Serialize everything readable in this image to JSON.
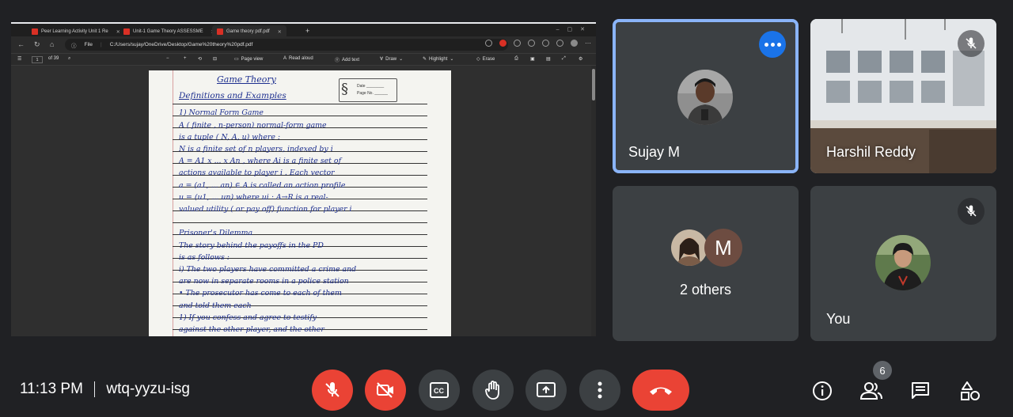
{
  "shared_screen": {
    "tabs": [
      {
        "label": "Peer Learning Activity Unit 1 Re"
      },
      {
        "label": "Unit-1 Game Theory ASSESSME"
      },
      {
        "label": "Game theory pdf.pdf"
      }
    ],
    "address": {
      "prefix": "File",
      "url": "C:/Users/sujay/OneDrive/Desktop/Game%20theory%20pdf.pdf"
    },
    "pdf_toolbar": {
      "page_current": "1",
      "page_total": "of 39",
      "page_view": "Page view",
      "read_aloud": "Read aloud",
      "add_text": "Add text",
      "draw": "Draw",
      "highlight": "Highlight",
      "erase": "Erase"
    },
    "document": {
      "title": "Game Theory",
      "subtitle": "Definitions and Examples",
      "stamp_date": "Date ________",
      "stamp_page": "Page No. ______",
      "lines": [
        "1) Normal Form Game",
        "    A ( finite , n-person) normal-form game",
        "is a tuple ( N, A, u) where :",
        "    N is a finite set of n players, indexed by i",
        "A = A1 x ... x An , where Ai is a finite set of",
        "actions available to player i . Each vector",
        "a = (a1, ... an) ∈ A is called an action profile",
        "u = (u1, ... un) where  ui : A→R is a real-",
        "valued utility ( or pay off) function for player i",
        "",
        "Prisoner's Dilemma",
        "    The story behind the payoffs in the PD",
        "is as follows :",
        "  i) The two players have committed a crime and",
        "are now in separate rooms in a police station",
        "  • The prosecutor has come to each of them",
        "and told them each",
        "      1) If you confess and agree to testify",
        "      against the other player, and the other"
      ]
    }
  },
  "participants": {
    "sujay": {
      "name": "Sujay M"
    },
    "harshil": {
      "name": "Harshil Reddy"
    },
    "others": {
      "initial": "M",
      "label": "2 others"
    },
    "you": {
      "name": "You"
    }
  },
  "meeting": {
    "time": "11:13 PM",
    "code": "wtq-yyzu-isg",
    "people_count": "6"
  },
  "colors": {
    "end_call": "#ea4335",
    "speaking_outline": "#8ab4f8",
    "more_button": "#1a73e8",
    "tile_bg": "#3c4043"
  }
}
